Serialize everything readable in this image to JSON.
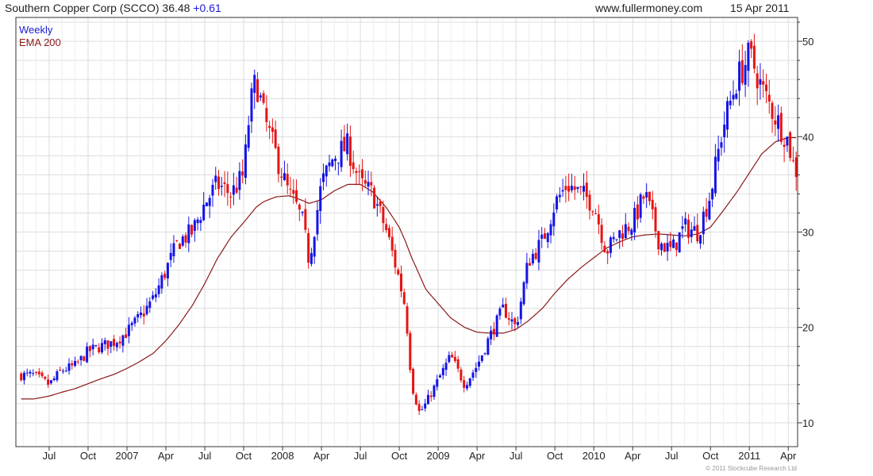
{
  "header": {
    "title": "Southern Copper Corp (SCCO) 36.48",
    "change": "+0.61",
    "site": "www.fullermoney.com",
    "date": "15 Apr 2011"
  },
  "legend": {
    "weekly": "Weekly",
    "ema": "EMA 200"
  },
  "copyright": "© 2011 Stockcube Research Ltd",
  "colors": {
    "up": "#1414e6",
    "down": "#e61414",
    "ema": "#8b1a1a",
    "grid": "#dcdcdc"
  },
  "chart_data": {
    "type": "candlestick",
    "x_tick_labels": [
      "Jul",
      "Oct",
      "2007",
      "Apr",
      "Jul",
      "Oct",
      "2008",
      "Apr",
      "Jul",
      "Oct",
      "2009",
      "Apr",
      "Jul",
      "Oct",
      "2010",
      "Apr",
      "Jul",
      "Oct",
      "2011",
      "Apr"
    ],
    "y_ticks": [
      10,
      20,
      30,
      40,
      50
    ],
    "ylim": [
      7.5,
      52.5
    ],
    "y_axis_position": "right",
    "grid": true,
    "legend_position": "top-left",
    "series": [
      {
        "name": "Weekly",
        "style": "candlestick",
        "x": [
          2006.4,
          2006.5,
          2006.58,
          2006.67,
          2006.75,
          2006.83,
          2006.92,
          2007.0,
          2007.08,
          2007.17,
          2007.25,
          2007.33,
          2007.42,
          2007.5,
          2007.58,
          2007.67,
          2007.75,
          2007.79,
          2007.83,
          2007.88,
          2007.96,
          2008.04,
          2008.08,
          2008.13,
          2008.17,
          2008.25,
          2008.33,
          2008.42,
          2008.5,
          2008.58,
          2008.67,
          2008.75,
          2008.79,
          2008.83,
          2008.88,
          2008.92,
          2009.0,
          2009.08,
          2009.17,
          2009.25,
          2009.33,
          2009.42,
          2009.5,
          2009.58,
          2009.67,
          2009.75,
          2009.83,
          2009.92,
          2010.0,
          2010.08,
          2010.17,
          2010.25,
          2010.33,
          2010.42,
          2010.5,
          2010.58,
          2010.67,
          2010.75,
          2010.83,
          2010.92,
          2011.0,
          2011.04,
          2011.08,
          2011.17,
          2011.25,
          2011.29
        ],
        "close": [
          15.0,
          14.0,
          15.5,
          16.0,
          17.5,
          18.0,
          18.5,
          19.5,
          21.0,
          23.0,
          26.0,
          29.0,
          30.0,
          33.0,
          35.0,
          34.0,
          36.0,
          43.0,
          46.0,
          42.0,
          38.0,
          34.0,
          33.0,
          31.0,
          27.0,
          35.0,
          38.0,
          39.0,
          35.0,
          34.0,
          30.0,
          25.0,
          22.0,
          14.0,
          11.0,
          12.0,
          14.5,
          17.0,
          14.0,
          16.0,
          19.0,
          22.0,
          20.0,
          27.0,
          29.0,
          33.0,
          35.0,
          34.0,
          33.0,
          28.0,
          30.0,
          31.0,
          34.0,
          29.0,
          28.0,
          30.5,
          30.0,
          34.0,
          41.0,
          46.0,
          48.5,
          47.0,
          45.0,
          42.0,
          39.5,
          36.48
        ],
        "ema200": [
          12.5,
          12.8,
          13.2,
          13.6,
          14.1,
          14.6,
          15.1,
          15.7,
          16.4,
          17.3,
          18.6,
          20.2,
          22.3,
          24.6,
          27.2,
          29.5,
          31.0,
          31.8,
          32.6,
          33.2,
          33.7,
          33.8,
          33.6,
          33.3,
          33.0,
          33.4,
          34.3,
          35.0,
          35.0,
          34.2,
          32.5,
          30.5,
          29.0,
          27.3,
          25.5,
          24.0,
          22.5,
          21.0,
          20.0,
          19.5,
          19.4,
          19.4,
          19.8,
          20.7,
          22.0,
          23.6,
          25.0,
          26.3,
          27.3,
          28.3,
          29.0,
          29.5,
          29.7,
          29.8,
          29.7,
          29.6,
          29.8,
          30.5,
          32.2,
          34.2,
          36.2,
          37.2,
          38.2,
          39.5,
          39.9,
          39.9
        ]
      },
      {
        "name": "EMA 200",
        "style": "line"
      }
    ]
  }
}
